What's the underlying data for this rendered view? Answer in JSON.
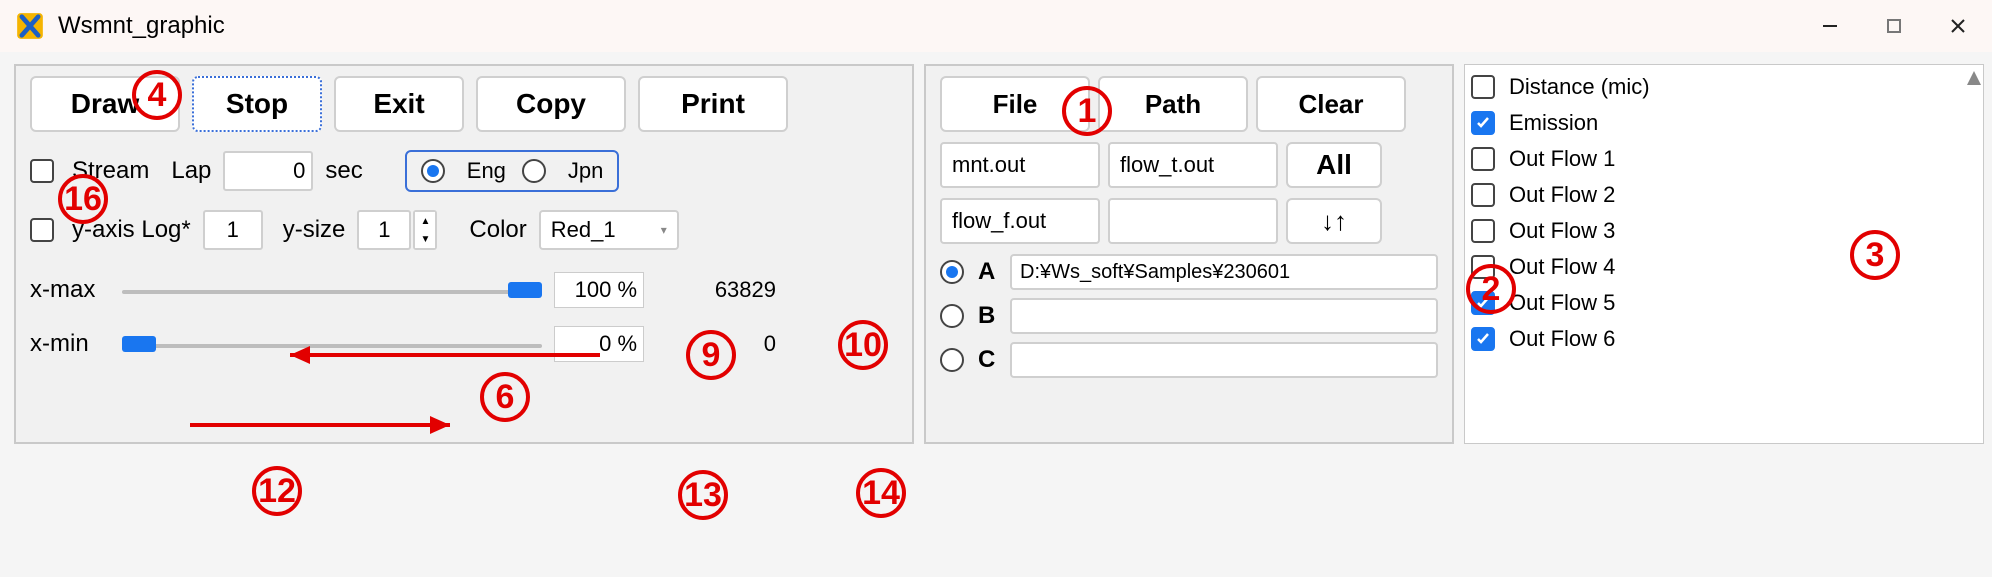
{
  "window": {
    "title": "Wsmnt_graphic"
  },
  "toolbar": {
    "draw": "Draw",
    "stop": "Stop",
    "exit": "Exit",
    "copy": "Copy",
    "print": "Print"
  },
  "left": {
    "stream": "Stream",
    "lap": "Lap",
    "lap_val": "0",
    "sec": "sec",
    "lang_eng": "Eng",
    "lang_jpn": "Jpn",
    "yaxis_log": "y-axis Log*",
    "yaxis_val": "1",
    "ysize": "y-size",
    "ysize_val": "1",
    "color_lbl": "Color",
    "color_val": "Red_1",
    "xmax": "x-max",
    "xmax_pct": "100",
    "xmax_pct_sfx": "%",
    "xmax_val": "63829",
    "xmin": "x-min",
    "xmin_pct": "0",
    "xmin_pct_sfx": "%",
    "xmin_val": "0"
  },
  "mid": {
    "file": "File",
    "path": "Path",
    "clear": "Clear",
    "f_mnt": "mnt.out",
    "f_flowt": "flow_t.out",
    "all": "All",
    "f_flowf": "flow_f.out",
    "f_blank": "",
    "sort": "↓↑",
    "A": "A",
    "A_path": "D:¥Ws_soft¥Samples¥230601",
    "B": "B",
    "B_path": "",
    "C": "C",
    "C_path": ""
  },
  "right": {
    "items": [
      {
        "label": "Distance (mic)",
        "checked": false
      },
      {
        "label": "Emission",
        "checked": true
      },
      {
        "label": "Out Flow 1",
        "checked": false
      },
      {
        "label": "Out Flow 2",
        "checked": false
      },
      {
        "label": "Out Flow 3",
        "checked": false
      },
      {
        "label": "Out Flow 4",
        "checked": false
      },
      {
        "label": "Out Flow 5",
        "checked": true
      },
      {
        "label": "Out Flow 6",
        "checked": true
      }
    ]
  },
  "ann": {
    "n1": "1",
    "n2": "2",
    "n3": "3",
    "n4": "4",
    "n6": "6",
    "n9": "9",
    "n10": "10",
    "n12": "12",
    "n13": "13",
    "n14": "14",
    "n16": "16"
  }
}
